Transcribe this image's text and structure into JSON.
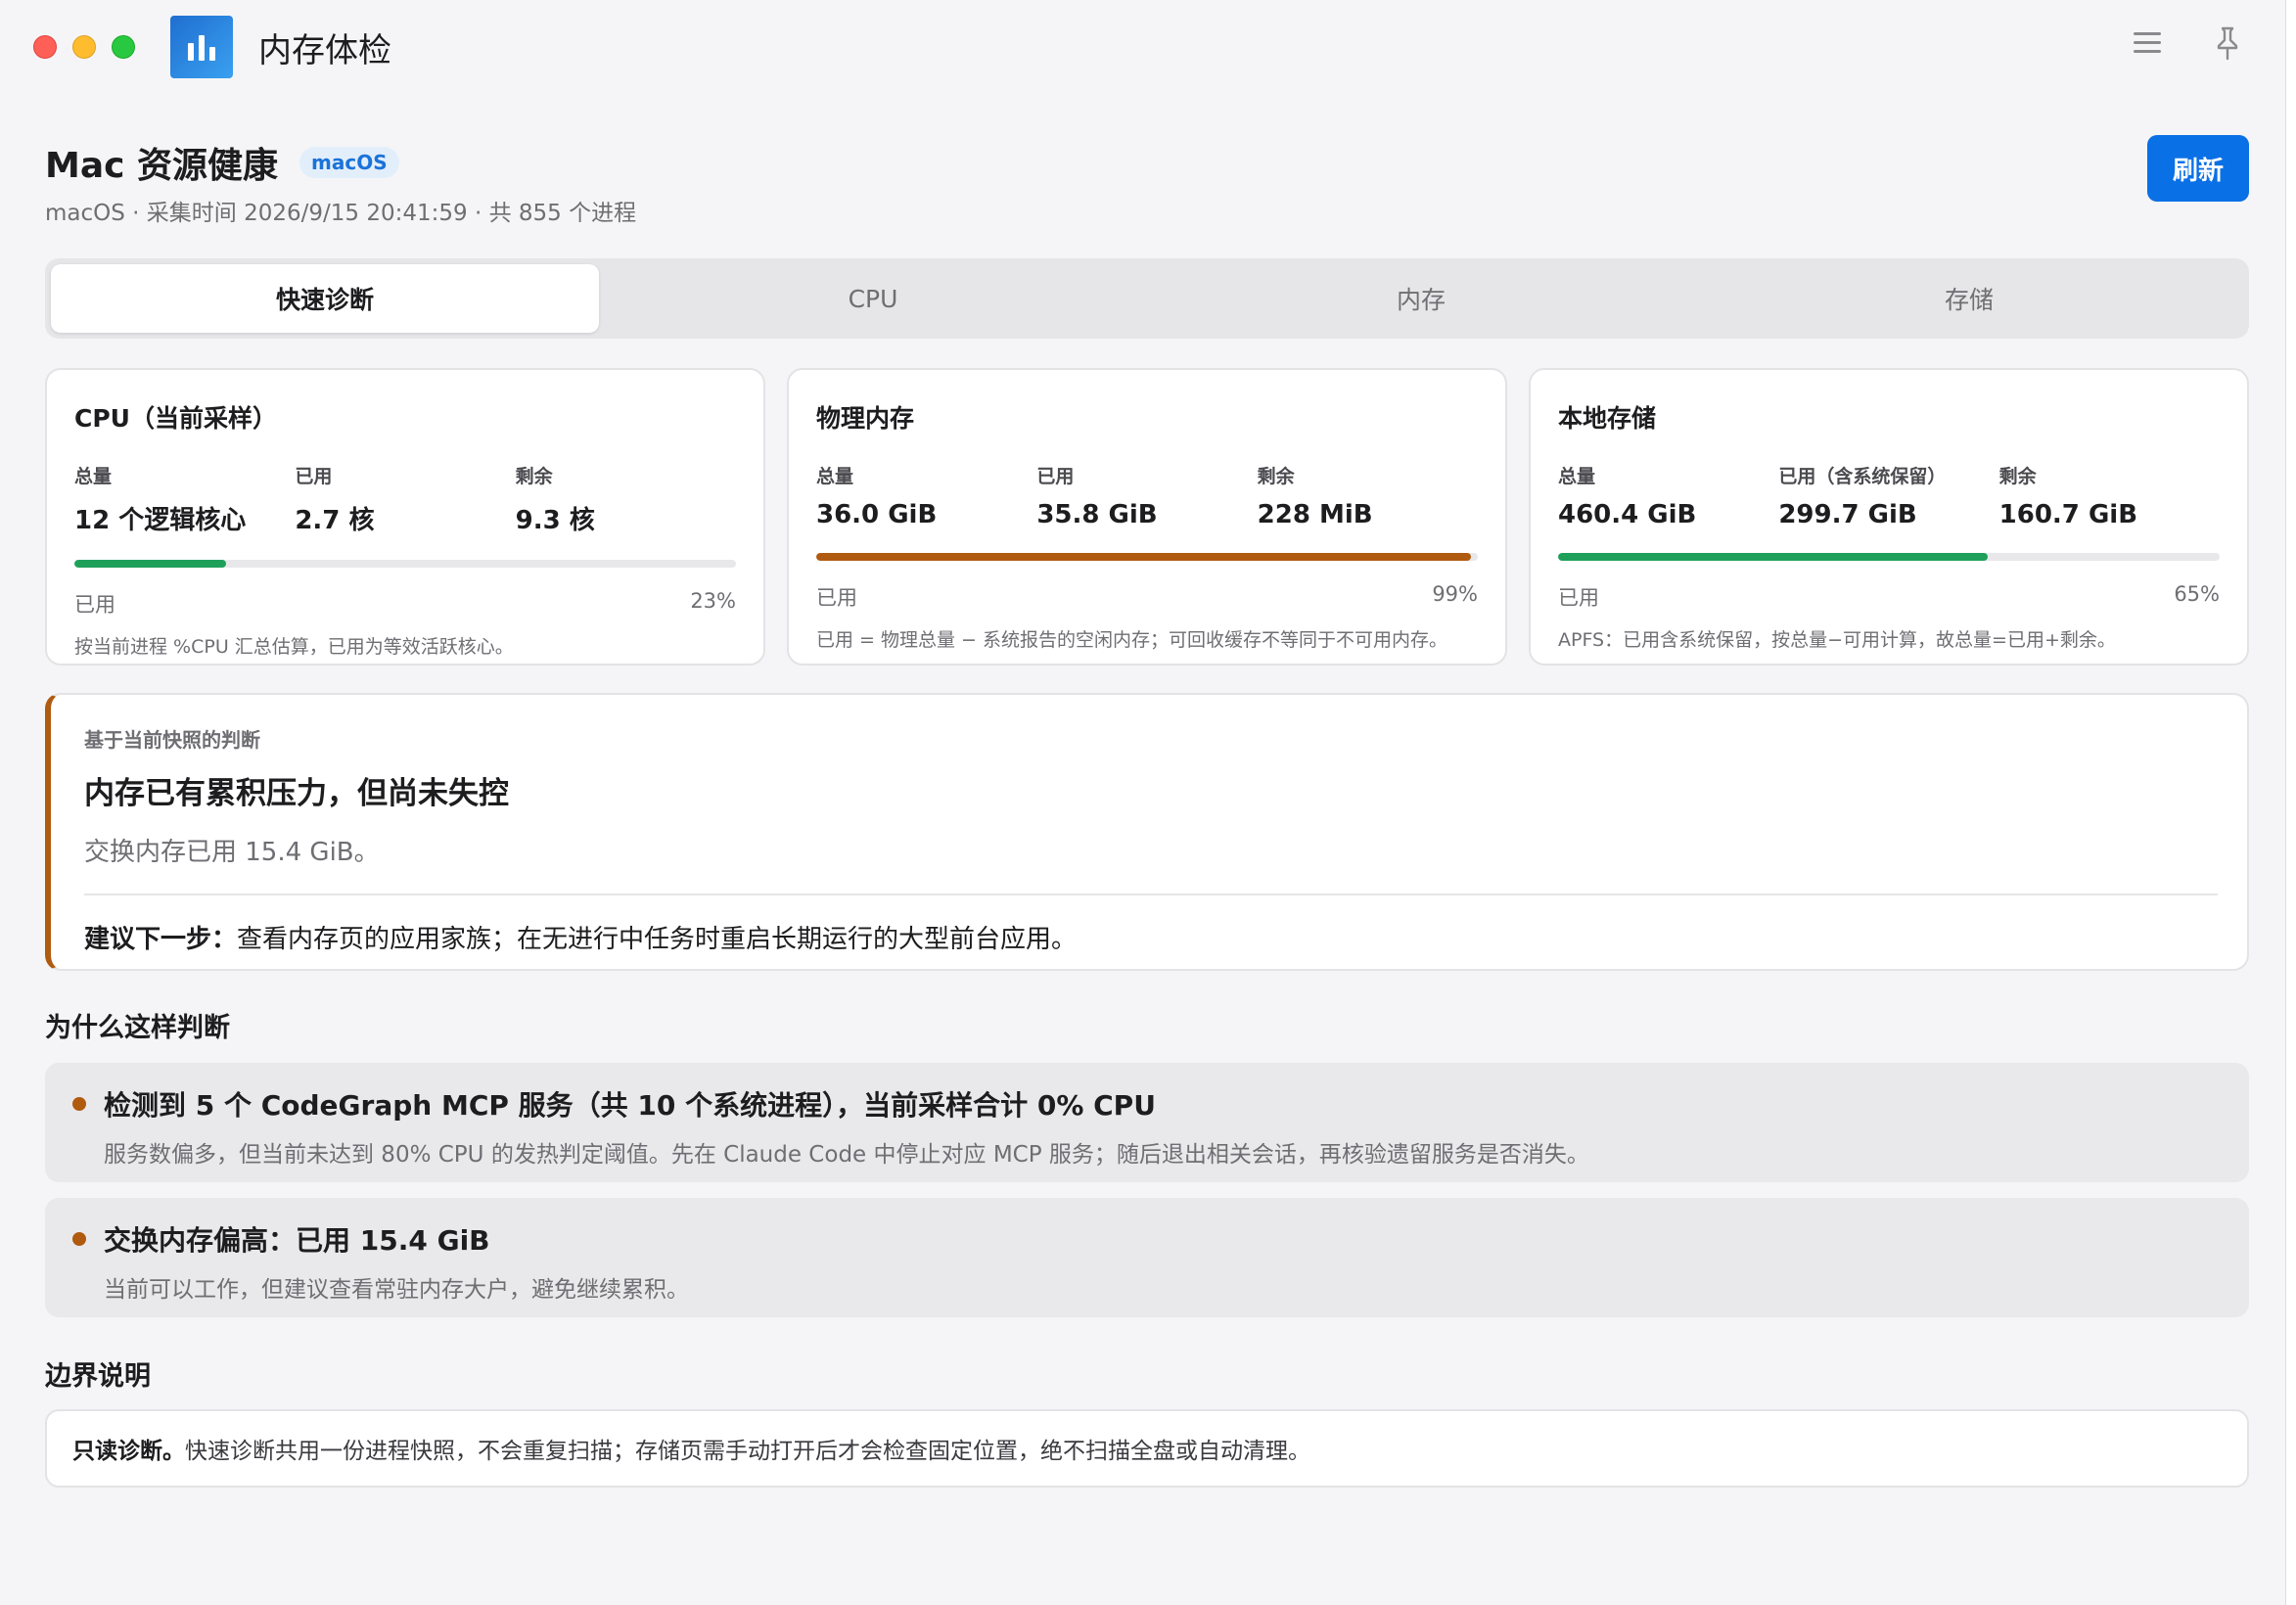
{
  "window": {
    "title": "内存体检"
  },
  "header": {
    "title": "Mac 资源健康",
    "badge": "macOS",
    "subtitle": "macOS · 采集时间 2026/9/15 20:41:59 · 共 855 个进程",
    "refresh_label": "刷新"
  },
  "tabs": [
    {
      "label": "快速诊断",
      "active": true
    },
    {
      "label": "CPU",
      "active": false
    },
    {
      "label": "内存",
      "active": false
    },
    {
      "label": "存储",
      "active": false
    }
  ],
  "cards": [
    {
      "title": "CPU（当前采样）",
      "stats": [
        {
          "label": "总量",
          "value": "12 个逻辑核心"
        },
        {
          "label": "已用",
          "value": "2.7 核"
        },
        {
          "label": "剩余",
          "value": "9.3 核"
        }
      ],
      "usage_fraction": 0.23,
      "bar_color": "#1fa05a",
      "used_label": "已用",
      "percent": "23%",
      "note": "按当前进程 %CPU 汇总估算，已用为等效活跃核心。"
    },
    {
      "title": "物理内存",
      "stats": [
        {
          "label": "总量",
          "value": "36.0 GiB"
        },
        {
          "label": "已用",
          "value": "35.8 GiB"
        },
        {
          "label": "剩余",
          "value": "228 MiB"
        }
      ],
      "usage_fraction": 0.99,
      "bar_color": "#b05a10",
      "used_label": "已用",
      "percent": "99%",
      "note": "已用 = 物理总量 − 系统报告的空闲内存；可回收缓存不等同于不可用内存。"
    },
    {
      "title": "本地存储",
      "stats": [
        {
          "label": "总量",
          "value": "460.4 GiB"
        },
        {
          "label": "已用（含系统保留）",
          "value": "299.7 GiB"
        },
        {
          "label": "剩余",
          "value": "160.7 GiB"
        }
      ],
      "usage_fraction": 0.65,
      "bar_color": "#1fa05a",
      "used_label": "已用",
      "percent": "65%",
      "note": "APFS：已用含系统保留，按总量−可用计算，故总量=已用+剩余。"
    }
  ],
  "judgment": {
    "eyebrow": "基于当前快照的判断",
    "headline": "内存已有累积压力，但尚未失控",
    "detail": "交换内存已用 15.4 GiB。",
    "next_label": "建议下一步：",
    "next_text": "查看内存页的应用家族；在无进行中任务时重启长期运行的大型前台应用。",
    "accent": "#b05a10"
  },
  "why": {
    "title": "为什么这样判断",
    "items": [
      {
        "title": "检测到 5 个 CodeGraph MCP 服务（共 10 个系统进程），当前采样合计 0% CPU",
        "desc": "服务数偏多，但当前未达到 80% CPU 的发热判定阈值。先在 Claude Code 中停止对应 MCP 服务；随后退出相关会话，再核验遗留服务是否消失。"
      },
      {
        "title": "交换内存偏高：已用 15.4 GiB",
        "desc": "当前可以工作，但建议查看常驻内存大户，避免继续累积。"
      }
    ]
  },
  "boundary": {
    "title": "边界说明",
    "bold": "只读诊断。",
    "text": "快速诊断共用一份进程快照，不会重复扫描；存储页需手动打开后才会检查固定位置，绝不扫描全盘或自动清理。"
  }
}
